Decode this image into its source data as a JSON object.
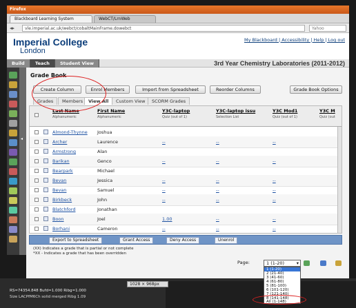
{
  "browser": {
    "app_name": "Firefox",
    "tabs": [
      {
        "label": "Blackboard Learning System",
        "active": true
      },
      {
        "label": "WebCT/LrnWeb",
        "active": false
      }
    ],
    "url": "vle.imperial.ac.uk/webct/cobaltMainFrame.dowebct",
    "search_placeholder": "Yahoo"
  },
  "header": {
    "logo_line1": "Imperial College",
    "logo_line2": "London",
    "links": "My Blackboard | Accessibility | Help | Log out"
  },
  "mode_tabs": [
    "Build",
    "Teach",
    "Student View"
  ],
  "course_title": "3rd Year Chemistry Laboratories (2011-2012)",
  "gradebook": {
    "title": "Grade Book",
    "buttons": {
      "create_column": "Create Column",
      "enrol_members": "Enrol Members",
      "import": "Import from Spreadsheet",
      "reorder": "Reorder Columns",
      "options": "Grade Book Options"
    },
    "view_tabs": [
      "Grades",
      "Members",
      "View All",
      "Custom View",
      "SCORM Grades"
    ],
    "active_view": "View All",
    "columns": [
      {
        "title": "Last Name",
        "sub": "Alphanumeric"
      },
      {
        "title": "First Name",
        "sub": "Alphanumeric"
      },
      {
        "title": "Y3C-laptop",
        "sub": "Quiz (out of 1)"
      },
      {
        "title": "Y3C-laptop issu",
        "sub": "Selection List"
      },
      {
        "title": "Y3C Mod1",
        "sub": "Quiz (out of 1)"
      },
      {
        "title": "Y3C M",
        "sub": "Quiz (out"
      }
    ],
    "rows": [
      {
        "last": "Almond-Thynne",
        "first": "Joshua",
        "g1": "",
        "g2": "",
        "g3": ""
      },
      {
        "last": "Archer",
        "first": "Laurence",
        "g1": "--",
        "g2": "--",
        "g3": "--"
      },
      {
        "last": "Armstrong",
        "first": "Alan",
        "g1": "",
        "g2": "",
        "g3": ""
      },
      {
        "last": "Barikan",
        "first": "Genco",
        "g1": "--",
        "g2": "--",
        "g3": "--"
      },
      {
        "last": "Bearpark",
        "first": "Michael",
        "g1": "",
        "g2": "",
        "g3": ""
      },
      {
        "last": "Bevan",
        "first": "Jessica",
        "g1": "--",
        "g2": "--",
        "g3": "--"
      },
      {
        "last": "Bevan",
        "first": "Samuel",
        "g1": "--",
        "g2": "--",
        "g3": "--"
      },
      {
        "last": "Birkbeck",
        "first": "John",
        "g1": "--",
        "g2": "--",
        "g3": "--"
      },
      {
        "last": "Blatchford",
        "first": "Jonathan",
        "g1": "",
        "g2": "",
        "g3": ""
      },
      {
        "last": "Boon",
        "first": "Joel",
        "g1": "1.00",
        "g2": "--",
        "g3": "--"
      },
      {
        "last": "Borhani",
        "first": "Cameron",
        "g1": "--",
        "g2": "--",
        "g3": "--"
      }
    ],
    "actions": [
      "Export to Spreadsheet",
      "Grant Access",
      "Deny Access",
      "Unenrol"
    ],
    "legend_line1": "(XX)  Indicates a grade that is partial or not complete",
    "legend_line2": "*XX - Indicates a grade that has been overridden"
  },
  "pager": {
    "label": "Page:",
    "selected": "1 (1-20)",
    "options": [
      "1 (1-20)",
      "2 (21-40)",
      "3 (41-60)",
      "4 (61-80)",
      "5 (81-100)",
      "6 (101-120)",
      "7 (121-140)",
      "8 (141-148)",
      "All (1-148)"
    ],
    "highlighted_index": 0
  },
  "status": {
    "size_readout": "1028 × 968px",
    "coords": "RS=74354.848  Bufd=1.000  Ribg=1.000",
    "console": "Size  LACPfM6Ch solid merged Ribg 1.09"
  },
  "colors": {
    "brand": "#0b3d7a",
    "action_bar": "#6f94c6",
    "annotation": "#dd2222"
  }
}
